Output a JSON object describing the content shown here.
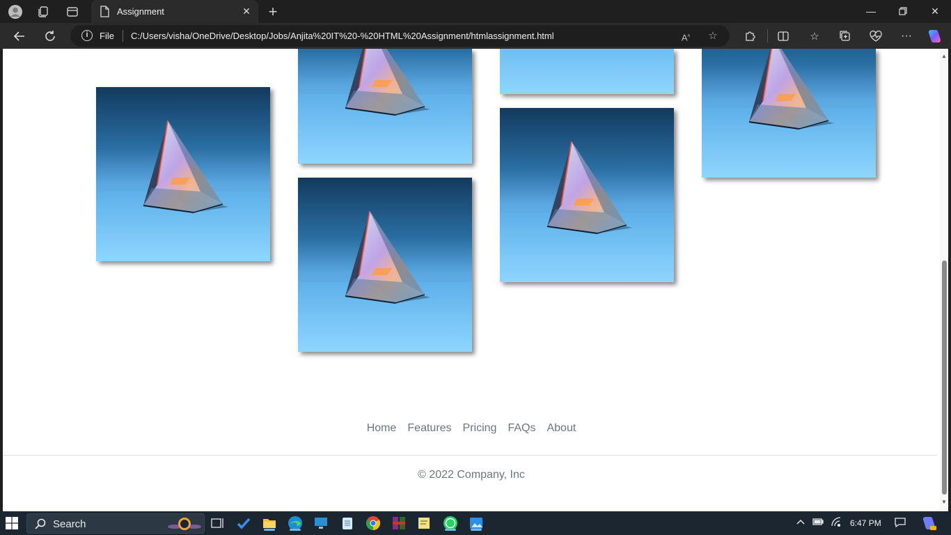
{
  "browser": {
    "tab_title": "Assignment",
    "address_scheme_label": "File",
    "url": "C:/Users/visha/OneDrive/Desktop/Jobs/Anjita%20IT%20-%20HTML%20Assignment/htmlassignment.html"
  },
  "gallery": {
    "image_subject": "glass prism on blue background",
    "tile_count": 7
  },
  "footer": {
    "nav": [
      "Home",
      "Features",
      "Pricing",
      "FAQs",
      "About"
    ],
    "copyright": "© 2022 Company, Inc"
  },
  "taskbar": {
    "search_label": "Search",
    "time": "6:47 PM"
  },
  "colors": {
    "accent": "#0d6efd",
    "footer_text": "#6c757d",
    "taskbar_bg": "#1c2630",
    "chrome_bg": "#2b2b2b"
  }
}
